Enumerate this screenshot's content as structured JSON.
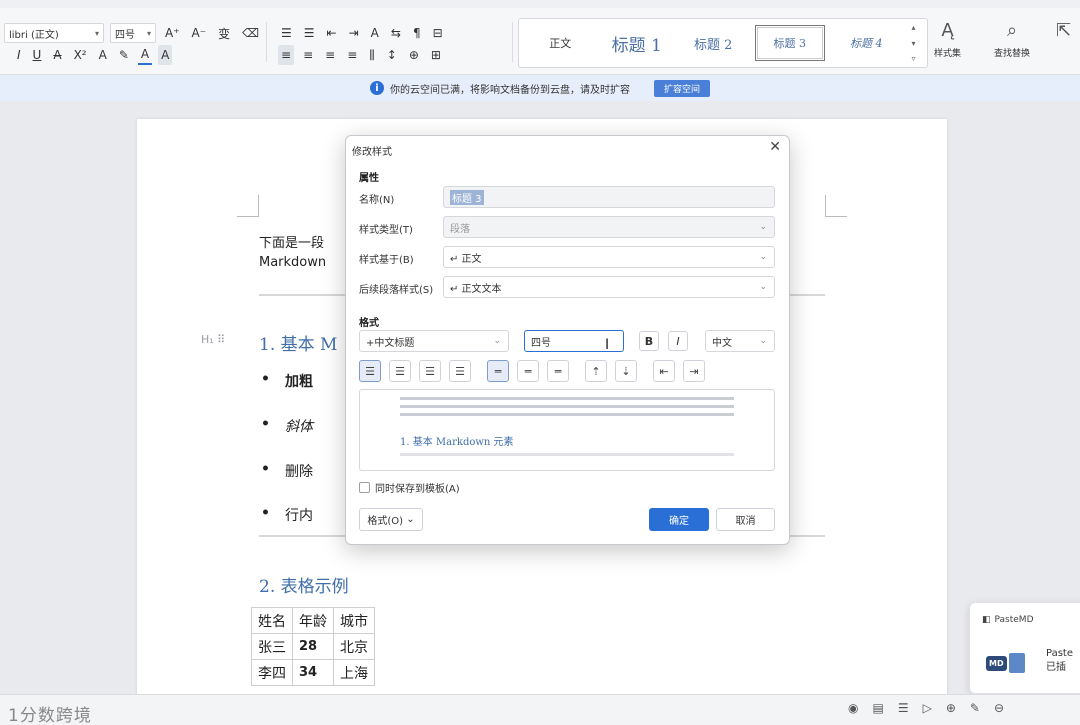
{
  "ribbon": {
    "font_name": "libri (正文)",
    "font_size": "四号",
    "font_tools_row1": [
      "A⁺",
      "A⁻",
      "变",
      "⌫"
    ],
    "font_tools_row2": [
      "I",
      "U",
      "A",
      "X²",
      "A",
      "✎",
      "A",
      "A"
    ],
    "para_tools_row1": [
      "☰",
      "☰",
      "⇤",
      "⇥",
      "A",
      "⇆",
      "¶",
      "⊟"
    ],
    "para_tools_row2": [
      "≡",
      "≡",
      "≡",
      "≡",
      "⫼",
      "↕",
      "⊕",
      "⊞"
    ],
    "styles": [
      "正文",
      "标题 1",
      "标题 2",
      "标题 3",
      "标题 4"
    ],
    "style_set": "样式集",
    "find_replace": "查找替换"
  },
  "notice": {
    "message": "你的云空间已满，将影响文档备份到云盘，请及时扩容",
    "button": "扩容空间"
  },
  "document": {
    "intro_line1": "下面是一段",
    "intro_line2": "Markdown",
    "heading1": "1. 基本 M",
    "bullets": [
      "加粗",
      "斜体",
      "删除",
      "行内"
    ],
    "heading2": "2. 表格示例",
    "table": {
      "headers": [
        "姓名",
        "年龄",
        "城市"
      ],
      "rows": [
        [
          "张三",
          "28",
          "北京"
        ],
        [
          "李四",
          "34",
          "上海"
        ]
      ]
    },
    "handle": "H₁ ⠿"
  },
  "dialog": {
    "title": "修改样式",
    "section_props": "属性",
    "name_label": "名称(N)",
    "name_value": "标题 3",
    "type_label": "样式类型(T)",
    "type_value": "段落",
    "based_label": "样式基于(B)",
    "based_value": "↵ 正文",
    "next_label": "后续段落样式(S)",
    "next_value": "↵ 正文文本",
    "section_format": "格式",
    "font_value": "+中文标题",
    "size_value": "四号",
    "bold": "B",
    "italic": "I",
    "lang_value": "中文",
    "preview_heading": "1. 基本 Markdown 元素",
    "preview_filler": "前一段落前一段落前一段落前一段落前一段落前一段落前一段落前一段落前一段落前一段落",
    "save_template": "同时保存到模板(A)",
    "format_btn": "格式(O)",
    "ok": "确定",
    "cancel": "取消"
  },
  "pastemd": {
    "title": "PasteMD",
    "badge": "MD",
    "line1": "Paste",
    "line2": "已插"
  },
  "status": {
    "watermark": "1分数跨境"
  }
}
